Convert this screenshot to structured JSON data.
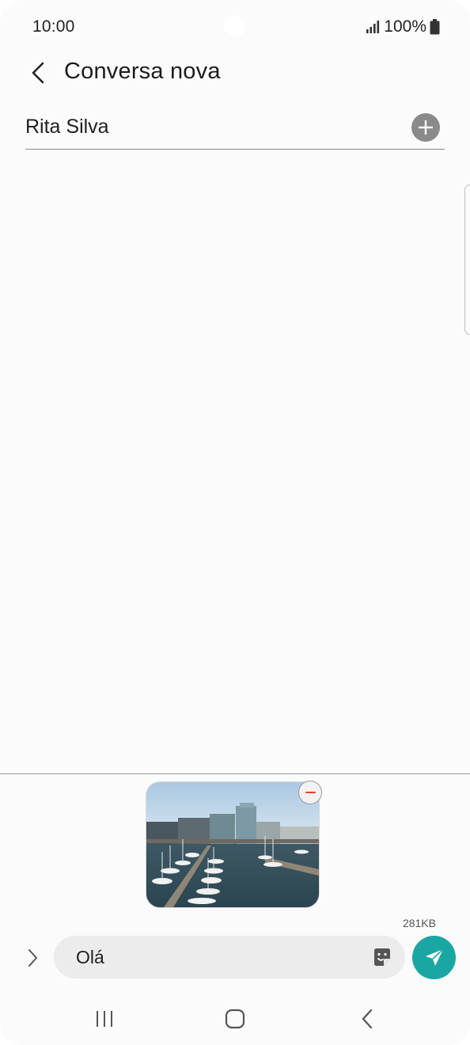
{
  "status_bar": {
    "time": "10:00",
    "battery_percent": "100%",
    "icons": [
      "signal-icon",
      "battery-icon"
    ]
  },
  "header": {
    "back_icon": "chevron-left-icon",
    "title": "Conversa nova"
  },
  "recipient": {
    "name": "Rita Silva",
    "add_icon": "plus-icon"
  },
  "attachment": {
    "type": "image",
    "remove_icon": "minus-icon",
    "size": "281KB"
  },
  "composer": {
    "expand_icon": "chevron-right-icon",
    "message_text": "Olá",
    "sticker_icon": "sticker-icon",
    "send_icon": "send-icon"
  },
  "colors": {
    "accent": "#1aa7a4",
    "remove": "#e2412d",
    "background": "#fbfbfb",
    "input_background": "#ececec"
  },
  "nav_bar": {
    "icons": [
      "recents-icon",
      "home-icon",
      "back-icon"
    ]
  }
}
